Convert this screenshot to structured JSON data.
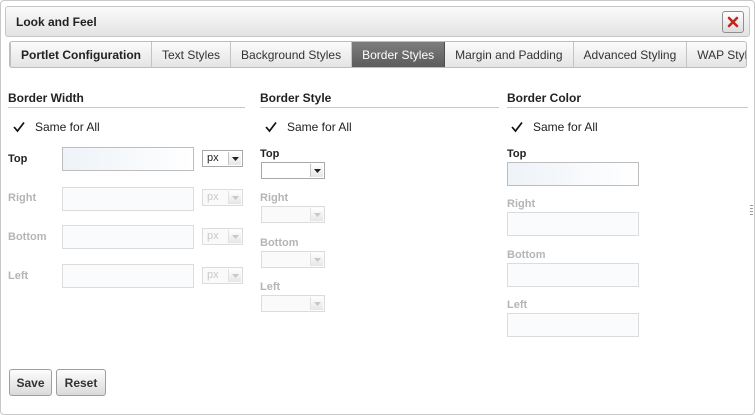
{
  "dialog": {
    "title": "Look and Feel"
  },
  "tabs": [
    {
      "label": "Portlet Configuration"
    },
    {
      "label": "Text Styles"
    },
    {
      "label": "Background Styles"
    },
    {
      "label": "Border Styles"
    },
    {
      "label": "Margin and Padding"
    },
    {
      "label": "Advanced Styling"
    },
    {
      "label": "WAP Styling"
    }
  ],
  "active_tab": "Border Styles",
  "border_width": {
    "heading": "Border Width",
    "same_for_all": {
      "label": "Same for All",
      "checked": true
    },
    "fields": [
      {
        "label": "Top",
        "value": "",
        "unit": "px",
        "enabled": true
      },
      {
        "label": "Right",
        "value": "",
        "unit": "px",
        "enabled": false
      },
      {
        "label": "Bottom",
        "value": "",
        "unit": "px",
        "enabled": false
      },
      {
        "label": "Left",
        "value": "",
        "unit": "px",
        "enabled": false
      }
    ]
  },
  "border_style": {
    "heading": "Border Style",
    "same_for_all": {
      "label": "Same for All",
      "checked": true
    },
    "fields": [
      {
        "label": "Top",
        "value": "",
        "enabled": true
      },
      {
        "label": "Right",
        "value": "",
        "enabled": false
      },
      {
        "label": "Bottom",
        "value": "",
        "enabled": false
      },
      {
        "label": "Left",
        "value": "",
        "enabled": false
      }
    ]
  },
  "border_color": {
    "heading": "Border Color",
    "same_for_all": {
      "label": "Same for All",
      "checked": true
    },
    "fields": [
      {
        "label": "Top",
        "value": "",
        "enabled": true
      },
      {
        "label": "Right",
        "value": "",
        "enabled": false
      },
      {
        "label": "Bottom",
        "value": "",
        "enabled": false
      },
      {
        "label": "Left",
        "value": "",
        "enabled": false
      }
    ]
  },
  "buttons": {
    "save": "Save",
    "reset": "Reset"
  },
  "icons": {
    "close": "close-icon",
    "check": "checkmark-icon",
    "dropdown": "dropdown-arrow-icon",
    "resize": "resize-grip-icon"
  },
  "colors": {
    "close_x": "#c0281e",
    "active_tab": "#6b6b6b"
  }
}
